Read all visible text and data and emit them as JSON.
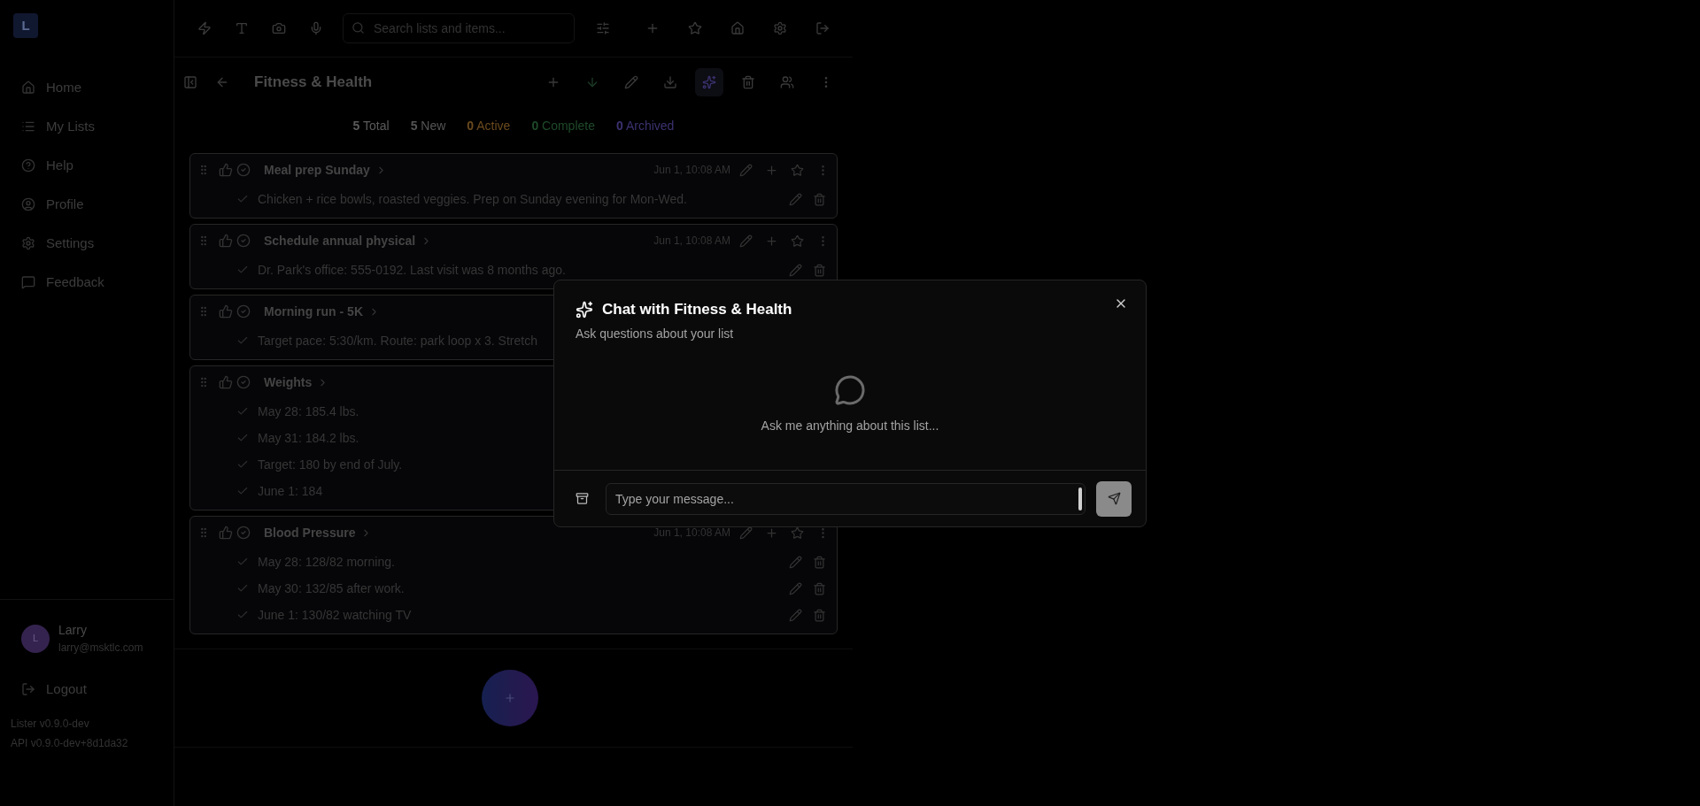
{
  "sidebar": {
    "logo": "L",
    "items": [
      {
        "label": "Home"
      },
      {
        "label": "My Lists"
      },
      {
        "label": "Help"
      },
      {
        "label": "Profile"
      },
      {
        "label": "Settings"
      },
      {
        "label": "Feedback"
      }
    ],
    "user": {
      "initial": "L",
      "name": "Larry",
      "email": "larry@msktlc.com"
    },
    "logout": "Logout",
    "versions": [
      "Lister v0.9.0-dev",
      "API v0.9.0-dev+8d1da32"
    ]
  },
  "topbar": {
    "search": {
      "placeholder": "Search lists and items..."
    }
  },
  "list": {
    "title": "Fitness & Health",
    "stats": [
      {
        "count": "5",
        "label": "Total",
        "color": "#5a5a5a"
      },
      {
        "count": "5",
        "label": "New",
        "color": "#555555"
      },
      {
        "count": "0",
        "label": "Active",
        "color": "#6b4a1e"
      },
      {
        "count": "0",
        "label": "Complete",
        "color": "#1f4a2a"
      },
      {
        "count": "0",
        "label": "Archived",
        "color": "#3b3270"
      }
    ],
    "cards": [
      {
        "title": "Meal prep Sunday",
        "date": "Jun 1, 10:08 AM",
        "entries": [
          "Chicken + rice bowls, roasted veggies. Prep on Sunday evening for Mon-Wed."
        ]
      },
      {
        "title": "Schedule annual physical",
        "date": "Jun 1, 10:08 AM",
        "entries": [
          "Dr. Park's office: 555-0192. Last visit was 8 months ago."
        ]
      },
      {
        "title": "Morning run - 5K",
        "entries": [
          "Target pace: 5:30/km. Route: park loop x 3. Stretch"
        ]
      },
      {
        "title": "Weights",
        "entries": [
          "May 28: 185.4 lbs.",
          "May 31: 184.2 lbs.",
          "Target: 180 by end of July.",
          "June 1: 184"
        ]
      },
      {
        "title": "Blood Pressure",
        "date": "Jun 1, 10:08 AM",
        "entries": [
          "May 28: 128/82 morning.",
          "May 30: 132/85 after work.",
          "June 1: 130/82  watching TV"
        ]
      }
    ]
  },
  "chat_dialog": {
    "title": "Chat with Fitness & Health",
    "subtitle": "Ask questions about your list",
    "empty_text": "Ask me anything about this list...",
    "input": {
      "placeholder": "Type your message..."
    }
  }
}
